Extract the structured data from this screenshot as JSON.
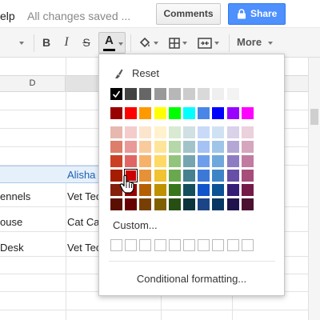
{
  "topbar": {
    "menu_help": "elp",
    "saved_status": "All changes saved ...",
    "comments_label": "Comments",
    "share_label": "Share"
  },
  "toolbar": {
    "bold": "B",
    "italic": "I",
    "strike": "S",
    "text_color": "A",
    "more": "More"
  },
  "grid": {
    "column_header": "D",
    "cells": [
      {
        "name": "cell-d-row-header-stub",
        "text": ""
      },
      {
        "name": "cell-alisha",
        "text": "Alisha"
      },
      {
        "name": "cell-kennels",
        "text": "ennels"
      },
      {
        "name": "cell-vet-tech-1",
        "text": "Vet Tec"
      },
      {
        "name": "cell-house",
        "text": "ouse"
      },
      {
        "name": "cell-cat-care",
        "text": "Cat Ca"
      },
      {
        "name": "cell-desk",
        "text": "Desk"
      },
      {
        "name": "cell-vet-tech-2",
        "text": "Vet Tec"
      }
    ]
  },
  "palette": {
    "reset_label": "Reset",
    "custom_label": "Custom...",
    "conditional_label": "Conditional formatting...",
    "grays": [
      "#000000",
      "#434343",
      "#666666",
      "#999999",
      "#b7b7b7",
      "#cccccc",
      "#d9d9d9",
      "#efefef",
      "#f3f3f3",
      "#ffffff"
    ],
    "brights": [
      "#980000",
      "#ff0000",
      "#ff9900",
      "#ffff00",
      "#00ff00",
      "#00ffff",
      "#4a86e8",
      "#0000ff",
      "#9900ff",
      "#ff00ff"
    ],
    "shades": [
      [
        "#e6b8af",
        "#f4cccc",
        "#fce5cd",
        "#fff2cc",
        "#d9ead3",
        "#d0e0e3",
        "#c9daf8",
        "#cfe2f3",
        "#d9d2e9",
        "#ead1dc"
      ],
      [
        "#dd7e6b",
        "#ea9999",
        "#f9cb9c",
        "#ffe599",
        "#b6d7a8",
        "#a2c4c9",
        "#a4c2f4",
        "#9fc5e8",
        "#b4a7d6",
        "#d5a6bd"
      ],
      [
        "#cc4125",
        "#e06666",
        "#f6b26b",
        "#ffd966",
        "#93c47d",
        "#76a5af",
        "#6d9eeb",
        "#6fa8dc",
        "#8e7cc3",
        "#c27ba0"
      ],
      [
        "#a61c00",
        "#cc0000",
        "#e69138",
        "#f1c232",
        "#6aa84f",
        "#45818e",
        "#3c78d8",
        "#3d85c6",
        "#674ea7",
        "#a64d79"
      ],
      [
        "#85200c",
        "#990000",
        "#b45f06",
        "#bf9000",
        "#38761d",
        "#134f5c",
        "#1155cc",
        "#0b5394",
        "#351c75",
        "#741b47"
      ],
      [
        "#5b0f00",
        "#660000",
        "#783f04",
        "#7f6000",
        "#274e13",
        "#0c343d",
        "#1c4587",
        "#073763",
        "#20124d",
        "#4c1130"
      ]
    ],
    "selected_gray_index": 0,
    "highlight_swatch": "#cc0000",
    "custom_slots": 10
  },
  "icons": {
    "lock": "lock-icon",
    "paint_bucket": "paint-bucket-icon",
    "borders": "borders-icon",
    "merge": "merge-cells-icon",
    "reset": "reset-brush-icon",
    "cursor": "hand-pointer-icon"
  }
}
